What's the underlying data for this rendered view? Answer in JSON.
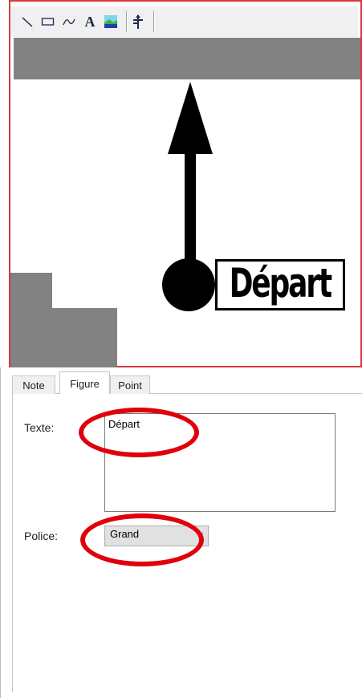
{
  "toolbar": {
    "tools": [
      {
        "icon": "line-tool-icon"
      },
      {
        "icon": "rectangle-tool-icon"
      },
      {
        "icon": "curve-tool-icon"
      },
      {
        "icon": "text-tool-icon",
        "glyph": "A"
      },
      {
        "icon": "image-tool-icon"
      },
      {
        "icon": "anchor-tool-icon"
      }
    ]
  },
  "canvas": {
    "label": "Départ"
  },
  "tabs": [
    "Note",
    "Figure",
    "Point"
  ],
  "active_tab": "Figure",
  "form": {
    "texte_label": "Texte:",
    "texte_value": "Départ",
    "police_label": "Police:",
    "police_value": "Grand"
  },
  "colors": {
    "highlight": "#e0000c",
    "canvas_border": "#d7383e",
    "gray_fill": "#828282"
  }
}
